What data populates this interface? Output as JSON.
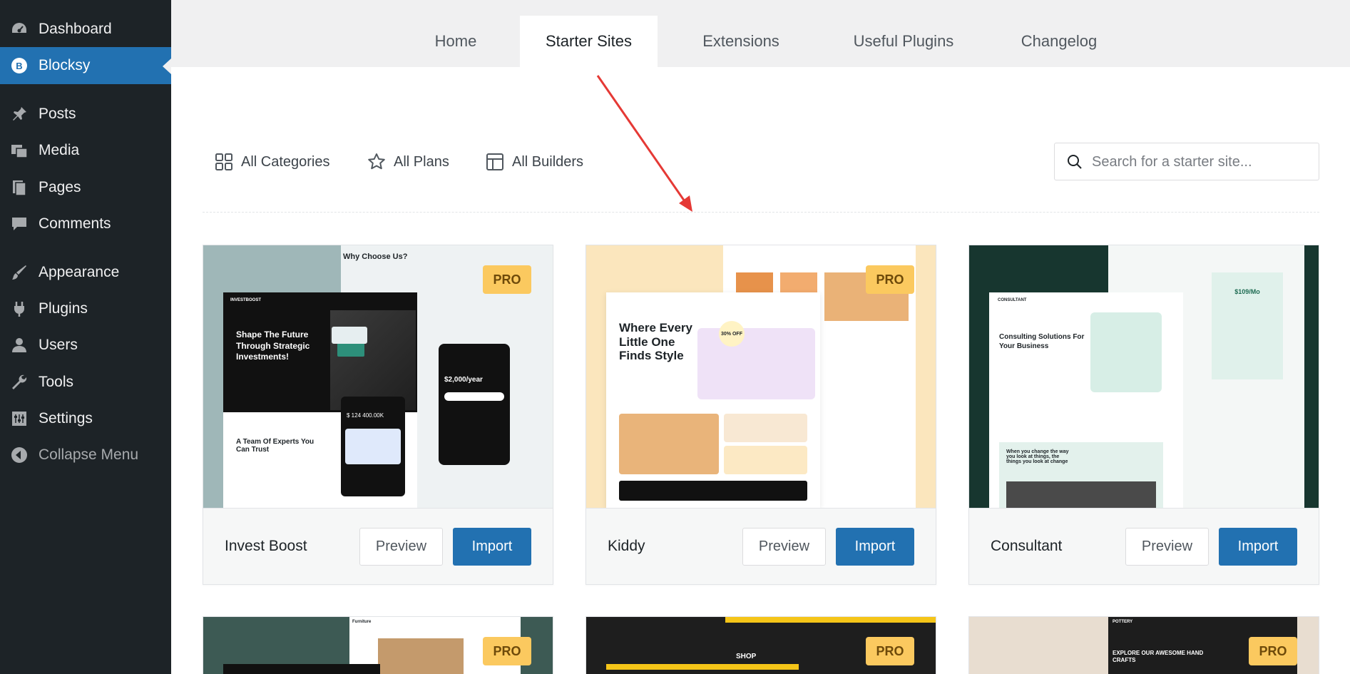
{
  "sidebar": {
    "items": [
      {
        "label": "Dashboard",
        "icon": "dashboard-icon"
      },
      {
        "label": "Blocksy",
        "icon": "blocksy-icon",
        "active": true
      },
      {
        "label": "Posts",
        "icon": "pin-icon"
      },
      {
        "label": "Media",
        "icon": "media-icon"
      },
      {
        "label": "Pages",
        "icon": "pages-icon"
      },
      {
        "label": "Comments",
        "icon": "comments-icon"
      },
      {
        "label": "Appearance",
        "icon": "brush-icon"
      },
      {
        "label": "Plugins",
        "icon": "plug-icon"
      },
      {
        "label": "Users",
        "icon": "user-icon"
      },
      {
        "label": "Tools",
        "icon": "wrench-icon"
      },
      {
        "label": "Settings",
        "icon": "settings-icon"
      },
      {
        "label": "Collapse Menu",
        "icon": "collapse-icon"
      }
    ]
  },
  "tabs": [
    {
      "label": "Home"
    },
    {
      "label": "Starter Sites",
      "active": true
    },
    {
      "label": "Extensions"
    },
    {
      "label": "Useful Plugins"
    },
    {
      "label": "Changelog"
    }
  ],
  "filters": {
    "categories": "All Categories",
    "plans": "All Plans",
    "builders": "All Builders"
  },
  "search": {
    "placeholder": "Search for a starter site...",
    "value": ""
  },
  "cards": [
    {
      "name": "Invest Boost",
      "badge": "PRO",
      "preview_label": "Preview",
      "import_label": "Import",
      "thumb": {
        "headline": "Shape The Future Through Strategic Investments!",
        "brand": "INVESTBOOST",
        "section": "Why Choose Us?",
        "sub": "A Team Of Experts You Can Trust",
        "price": "$2,000/year",
        "amount": "$ 124 400.00K"
      }
    },
    {
      "name": "Kiddy",
      "badge": "PRO",
      "preview_label": "Preview",
      "import_label": "Import",
      "thumb": {
        "headline": "Where Every Little One Finds Style",
        "discount": "30% OFF"
      }
    },
    {
      "name": "Consultant",
      "badge": null,
      "preview_label": "Preview",
      "import_label": "Import",
      "thumb": {
        "brand": "CONSULTANT",
        "headline": "Consulting Solutions For Your Business",
        "sub": "When you change the way you look at things, the things you look at change",
        "price": "$109/Mo"
      }
    },
    {
      "name": "",
      "badge": "PRO",
      "thumb": {
        "brand": "Furniture"
      }
    },
    {
      "name": "",
      "badge": "PRO",
      "thumb": {
        "headline": "SHOP"
      }
    },
    {
      "name": "",
      "badge": "PRO",
      "thumb": {
        "brand": "POTTERY",
        "headline": "EXPLORE OUR AWESOME HAND CRAFTS"
      }
    }
  ],
  "colors": {
    "sidebar_bg": "#1d2327",
    "active_blue": "#2271b1",
    "pro_badge": "#fbc95f",
    "annotation_arrow": "#e53935"
  }
}
